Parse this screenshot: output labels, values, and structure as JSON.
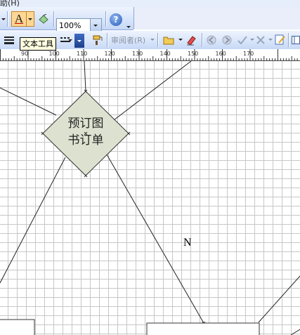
{
  "menu": {
    "fragment": "助(H)"
  },
  "toolbar1": {
    "text_tool_letter": "A",
    "zoom_value": "100%",
    "help_glyph": "?"
  },
  "toolbar2": {
    "tooltip": "文本工具",
    "reviewer_label": "审阅者(R)"
  },
  "ruler": {
    "ticks": [
      "90",
      "100",
      "110",
      "120",
      "130",
      "140",
      "150",
      "160",
      "170"
    ]
  },
  "diagram": {
    "relationship_label_line1": "预订图",
    "relationship_label_line2": "书订单",
    "cardinality": "N"
  },
  "colors": {
    "toolbar": "#c6d8f7",
    "diamond_fill": "#dde2d0",
    "grid": "#c7c7c7"
  },
  "icons": [
    "line-weight-icon",
    "text-tool-icon",
    "fill-icon",
    "help-icon",
    "format-painter-icon",
    "folder-icon",
    "eraser-icon",
    "back-icon",
    "forward-icon",
    "accept-icon",
    "reject-icon",
    "edit-icon",
    "panel-icon"
  ]
}
